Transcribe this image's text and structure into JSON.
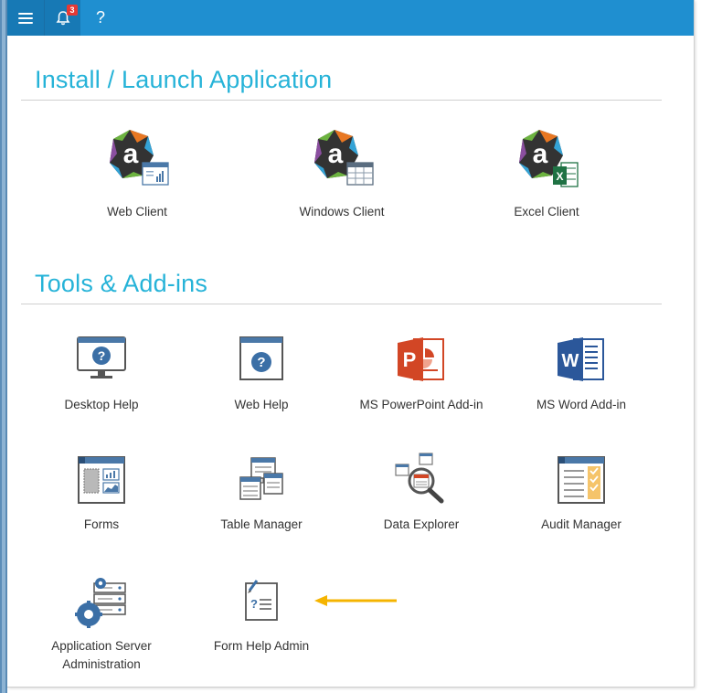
{
  "toolbar": {
    "notification_count": "3",
    "help_label": "?"
  },
  "install_section": {
    "title": "Install / Launch Application",
    "items": [
      {
        "label": "Web Client"
      },
      {
        "label": "Windows Client"
      },
      {
        "label": "Excel Client"
      }
    ]
  },
  "tools_section": {
    "title": "Tools & Add-ins",
    "items": [
      {
        "label": "Desktop Help"
      },
      {
        "label": "Web Help"
      },
      {
        "label": "MS PowerPoint Add-in"
      },
      {
        "label": "MS Word Add-in"
      },
      {
        "label": "Forms"
      },
      {
        "label": "Table Manager"
      },
      {
        "label": "Data Explorer"
      },
      {
        "label": "Audit Manager"
      },
      {
        "label": "Application Server\nAdministration"
      },
      {
        "label": "Form Help Admin"
      }
    ]
  },
  "icon_names": [
    "menu-icon",
    "bell-icon",
    "help-icon",
    "axiom-web-client-icon",
    "axiom-windows-client-icon",
    "axiom-excel-client-icon",
    "desktop-help-icon",
    "web-help-icon",
    "powerpoint-icon",
    "word-icon",
    "forms-icon",
    "table-manager-icon",
    "data-explorer-icon",
    "audit-manager-icon",
    "app-server-admin-icon",
    "form-help-admin-icon",
    "arrow-left-icon"
  ],
  "colors": {
    "topbar": "#1f8fd0",
    "topbar_dark": "#1779b5",
    "title": "#26b3d8",
    "badge": "#e53935",
    "arrow": "#f5b400",
    "powerpoint": "#d24625",
    "word": "#2b579a",
    "excel": "#1f7244"
  }
}
